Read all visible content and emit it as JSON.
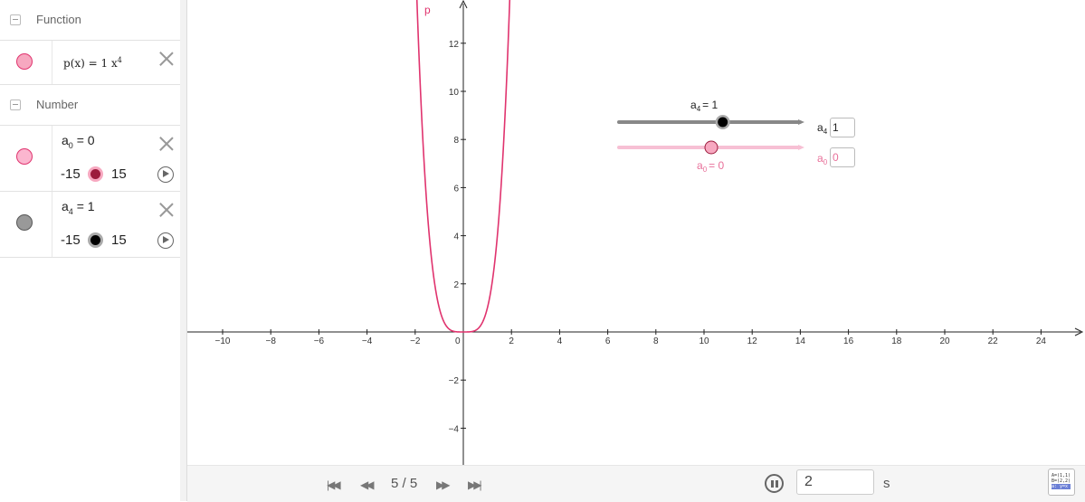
{
  "algebra": {
    "function_header": "Function",
    "function_row": {
      "name": "p",
      "arg": "x",
      "coef": "1",
      "var": "x",
      "power": "4"
    },
    "number_header": "Number",
    "sliders": [
      {
        "name": "a",
        "sub": "0",
        "value": "0",
        "min": "-15",
        "max": "15",
        "knob_color": "#9c1b3c"
      },
      {
        "name": "a",
        "sub": "4",
        "value": "1",
        "min": "-15",
        "max": "15",
        "knob_color": "#000000"
      }
    ]
  },
  "graph": {
    "curve_label": "p",
    "curve_color": "#e0336e",
    "x_ticks": [
      "−10",
      "−8",
      "−6",
      "−4",
      "−2",
      "0",
      "2",
      "4",
      "6",
      "8",
      "10",
      "12",
      "14",
      "16",
      "18",
      "20",
      "22",
      "24"
    ],
    "x_values": [
      -10,
      -8,
      -6,
      -4,
      -2,
      0,
      2,
      4,
      6,
      8,
      10,
      12,
      14,
      16,
      18,
      20,
      22,
      24
    ],
    "y_ticks": [
      "12",
      "10",
      "8",
      "6",
      "4",
      "2",
      "−2",
      "−4"
    ],
    "y_values": [
      12,
      10,
      8,
      6,
      4,
      2,
      -2,
      -4
    ],
    "slider_a4": {
      "label_name": "a",
      "label_sub": "4",
      "label_value": "= 1",
      "box_name": "a",
      "box_sub": "4",
      "box_value": "1",
      "value": 1,
      "min": -15,
      "max": 15
    },
    "slider_a0": {
      "label_name": "a",
      "label_sub": "0",
      "label_value": "= 0",
      "box_name": "a",
      "box_sub": "0",
      "box_value": "0",
      "value": 0,
      "min": -15,
      "max": 15
    }
  },
  "bottombar": {
    "page_indicator": "5 / 5",
    "step_value": "2",
    "step_unit": "s",
    "view_icon_lines": [
      "A=(1,1)",
      "B=(2,2)",
      "a: y=x"
    ]
  }
}
